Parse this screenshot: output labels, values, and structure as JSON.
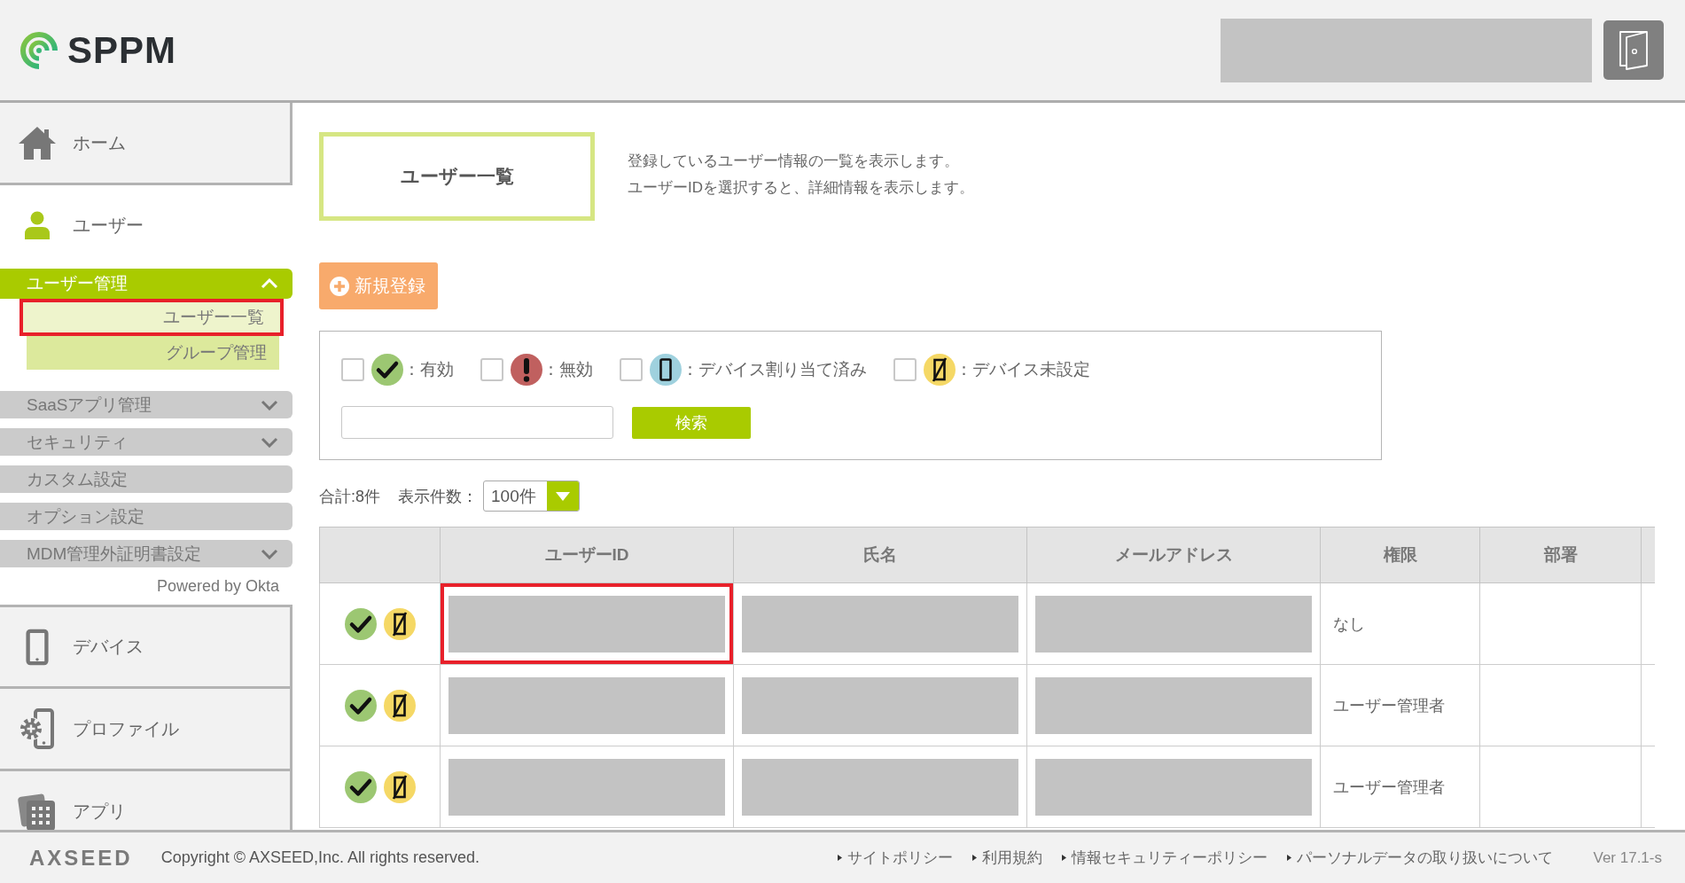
{
  "header": {
    "logo_text": "SPPM"
  },
  "sidebar": {
    "nav_top": [
      {
        "label": "ホーム",
        "selected": false
      },
      {
        "label": "ユーザー",
        "selected": true
      }
    ],
    "menus": [
      {
        "label": "ユーザー管理",
        "expandable": true,
        "expanded": true,
        "children": [
          {
            "label": "ユーザー一覧",
            "selected": true,
            "marked": true
          },
          {
            "label": "グループ管理",
            "selected": false,
            "marked": false
          }
        ]
      },
      {
        "label": "SaaSアプリ管理",
        "expandable": true,
        "expanded": false
      },
      {
        "label": "セキュリティ",
        "expandable": true,
        "expanded": false
      },
      {
        "label": "カスタム設定",
        "expandable": false,
        "expanded": false
      },
      {
        "label": "オプション設定",
        "expandable": false,
        "expanded": false
      },
      {
        "label": "MDM管理外証明書設定",
        "expandable": true,
        "expanded": false
      }
    ],
    "powered_by": "Powered by Okta",
    "nav_bottom": [
      {
        "label": "デバイス",
        "selected": false
      },
      {
        "label": "プロファイル",
        "selected": false
      },
      {
        "label": "アプリ",
        "selected": false
      }
    ]
  },
  "main": {
    "title": "ユーザー一覧",
    "description": [
      "登録しているユーザー情報の一覧を表示します。",
      "ユーザーIDを選択すると、詳細情報を表示します。"
    ],
    "new_button": "新規登録",
    "filters": [
      {
        "kind": "active",
        "label": "：有効",
        "checked": false
      },
      {
        "kind": "inactive",
        "label": "：無効",
        "checked": false
      },
      {
        "kind": "assigned",
        "label": "：デバイス割り当て済み",
        "checked": false
      },
      {
        "kind": "unassigned",
        "label": "：デバイス未設定",
        "checked": false
      }
    ],
    "search_button": "検索",
    "total": "合計:8件",
    "page_size_label": "表示件数：",
    "page_size": "100件",
    "table": {
      "columns": [
        "ユーザーID",
        "氏名",
        "メールアドレス",
        "権限",
        "部署"
      ],
      "rows": [
        {
          "statuses": [
            {
              "kind": "active"
            },
            {
              "kind": "unassigned"
            }
          ],
          "role": "なし",
          "marked": true
        },
        {
          "statuses": [
            {
              "kind": "active"
            },
            {
              "kind": "unassigned"
            }
          ],
          "role": "ユーザー管理者",
          "marked": false
        },
        {
          "statuses": [
            {
              "kind": "active"
            },
            {
              "kind": "unassigned"
            }
          ],
          "role": "ユーザー管理者",
          "marked": false
        }
      ]
    }
  },
  "footer": {
    "logo": "AXSEED",
    "copyright": "Copyright © AXSEED,Inc. All rights reserved.",
    "links": [
      "サイトポリシー",
      "利用規約",
      "情報セキュリティーポリシー",
      "パーソナルデータの取り扱いについて"
    ],
    "version": "Ver 17.1-s"
  }
}
